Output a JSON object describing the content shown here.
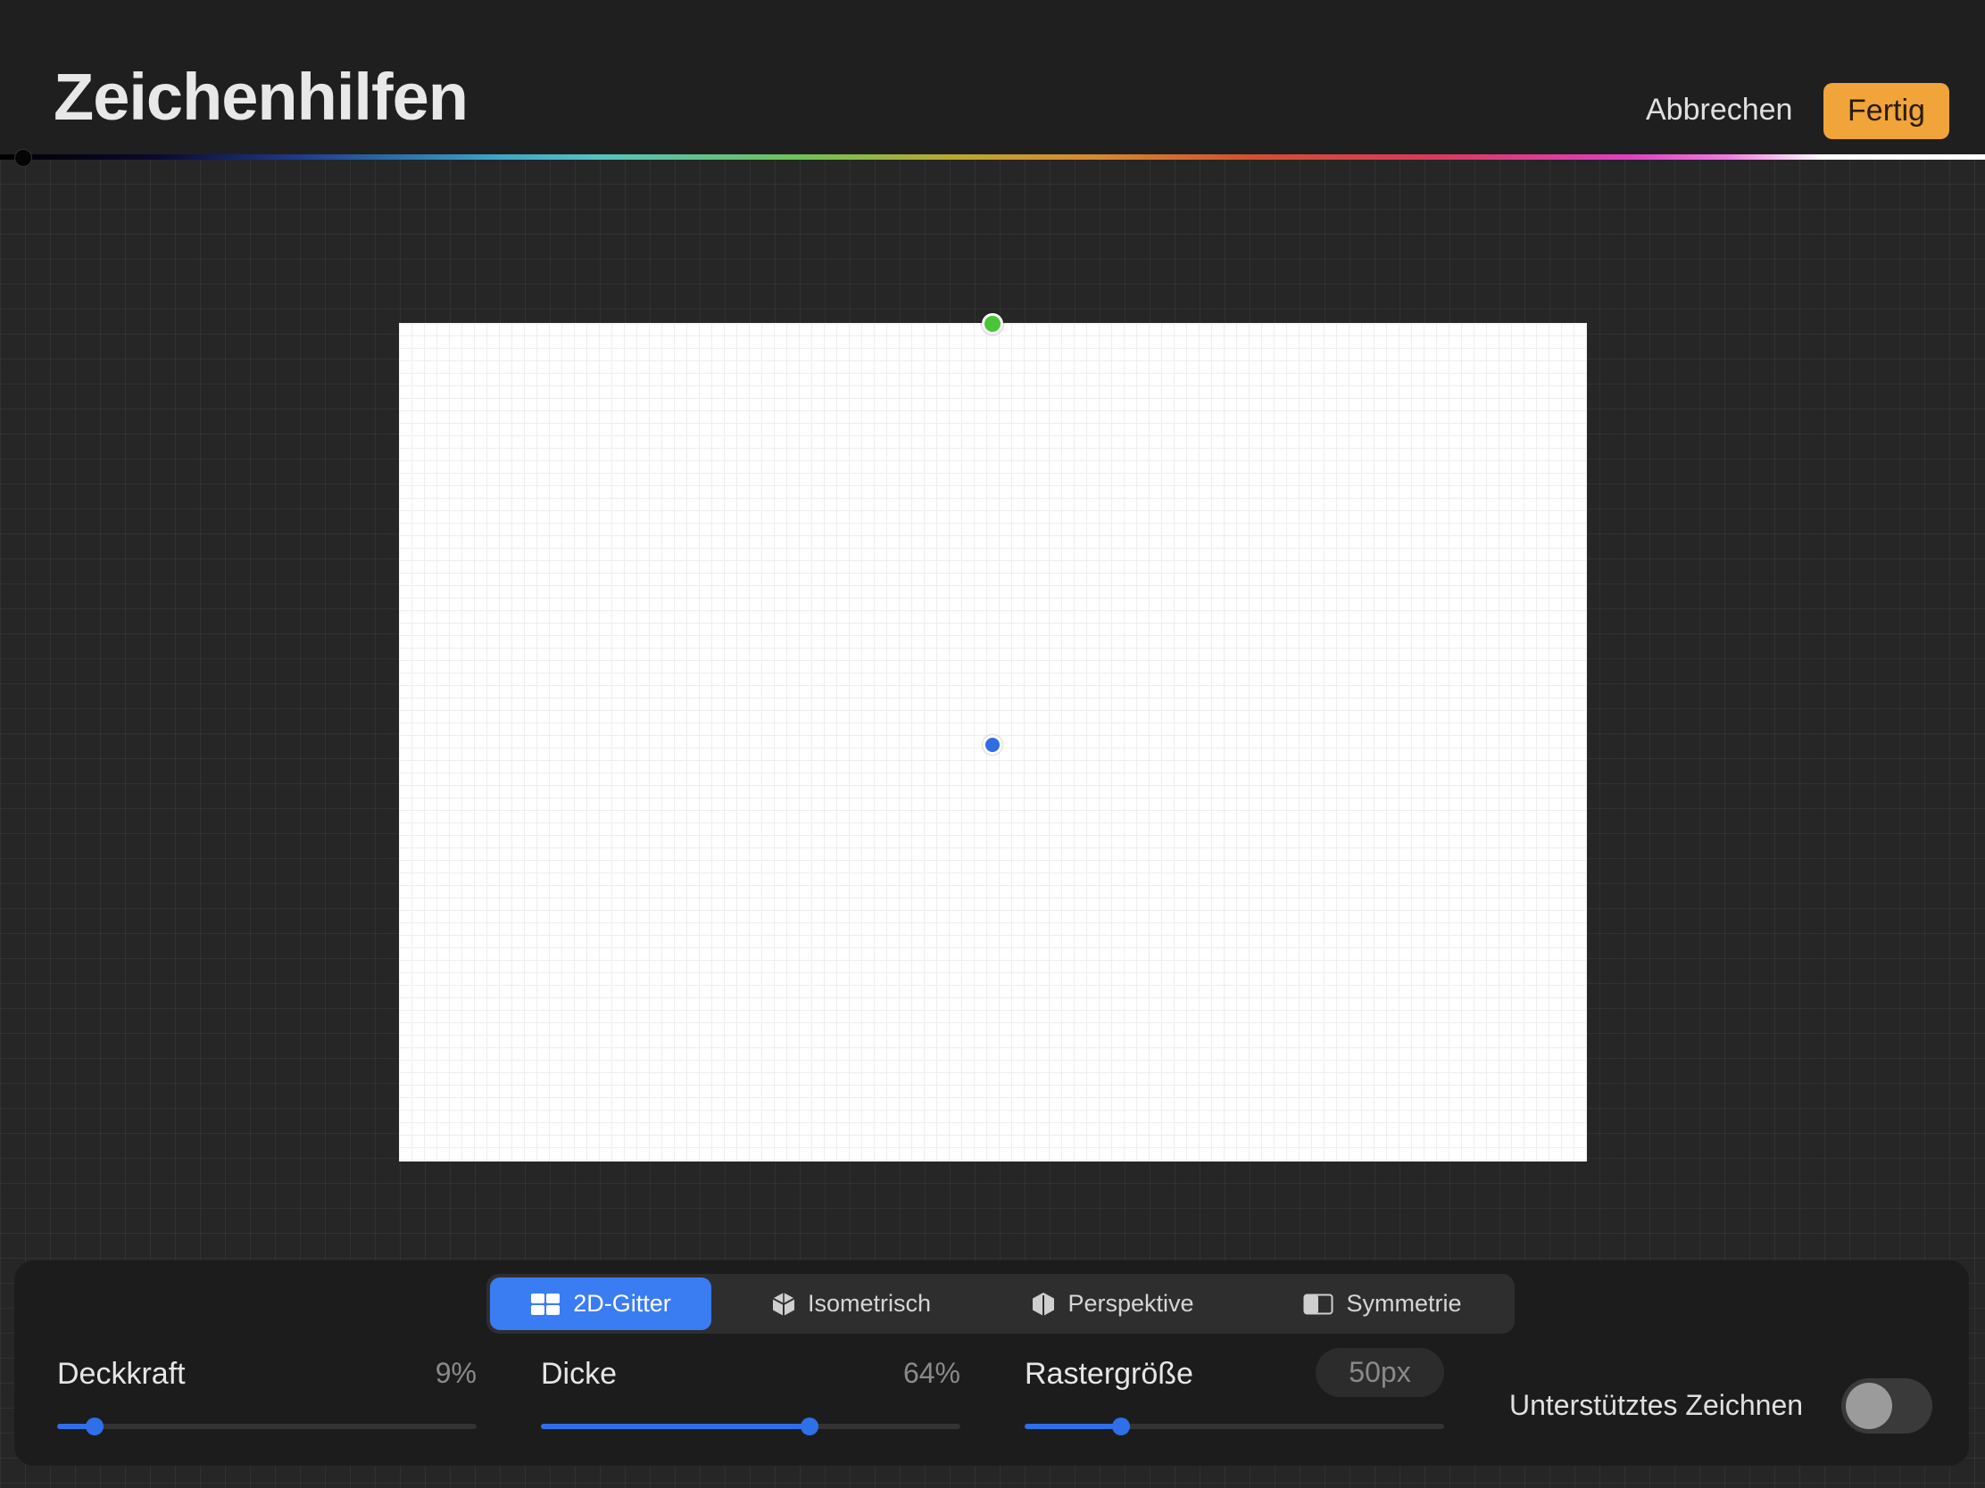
{
  "header": {
    "title": "Zeichenhilfen",
    "cancel_label": "Abbrechen",
    "done_label": "Fertig"
  },
  "guide_tabs": [
    {
      "label": "2D-Gitter",
      "icon": "grid-2d-icon",
      "active": true
    },
    {
      "label": "Isometrisch",
      "icon": "isometric-cube-icon",
      "active": false
    },
    {
      "label": "Perspektive",
      "icon": "perspective-cube-icon",
      "active": false
    },
    {
      "label": "Symmetrie",
      "icon": "symmetry-icon",
      "active": false
    }
  ],
  "sliders": {
    "opacity": {
      "label": "Deckkraft",
      "value": "9%",
      "fraction": 0.09
    },
    "thickness": {
      "label": "Dicke",
      "value": "64%",
      "fraction": 0.64
    },
    "grid_size": {
      "label": "Rastergröße",
      "value": "50px",
      "fraction": 0.23
    }
  },
  "assisted_drawing": {
    "label": "Unterstütztes Zeichnen",
    "enabled": false
  },
  "colors": {
    "accent_blue": "#3a7cf2",
    "done_orange": "#f0a43a",
    "handle_green": "#4cc43a",
    "handle_blue": "#2f6de0"
  }
}
